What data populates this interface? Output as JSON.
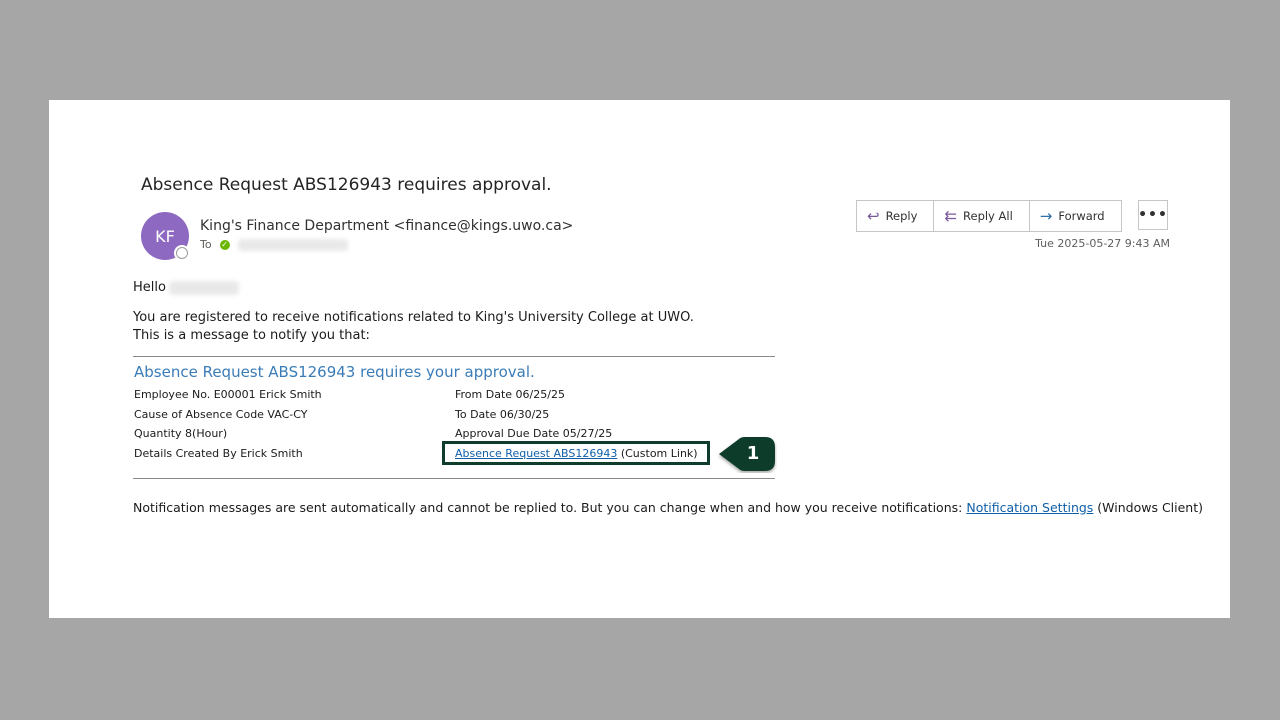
{
  "email": {
    "subject": "Absence Request ABS126943 requires approval.",
    "avatar_initials": "KF",
    "sender": "King's Finance Department <finance@kings.uwo.ca>",
    "to_label": "To",
    "date": "Tue 2025-05-27 9:43 AM"
  },
  "actions": {
    "reply": "Reply",
    "reply_all": "Reply All",
    "forward": "Forward",
    "more": "•••"
  },
  "body": {
    "greeting": "Hello",
    "intro_line1": "You are registered to receive notifications related to King's University College at UWO.",
    "intro_line2": "This is a message to notify you that:",
    "heading": "Absence Request ABS126943 requires your approval.",
    "details": {
      "employee": "Employee No. E00001 Erick Smith",
      "from_date": "From Date 06/25/25",
      "cause": "Cause of Absence Code VAC-CY",
      "to_date": "To Date 06/30/25",
      "quantity": "Quantity 8(Hour)",
      "approval_due": "Approval Due Date 05/27/25",
      "created_by": "Details Created By Erick Smith",
      "link_text": "Absence Request ABS126943",
      "link_suffix": "(Custom Link)"
    },
    "footer_text": "Notification messages are sent automatically and cannot be replied to. But you can change when and how you receive notifications:",
    "footer_link": "Notification Settings",
    "footer_suffix": "(Windows Client)"
  },
  "callout": {
    "number": "1",
    "color": "#0e3d2c"
  },
  "icons": {
    "reply": "reply-icon",
    "reply_all": "reply-all-icon",
    "forward": "forward-icon",
    "check": "presence-available-icon"
  }
}
